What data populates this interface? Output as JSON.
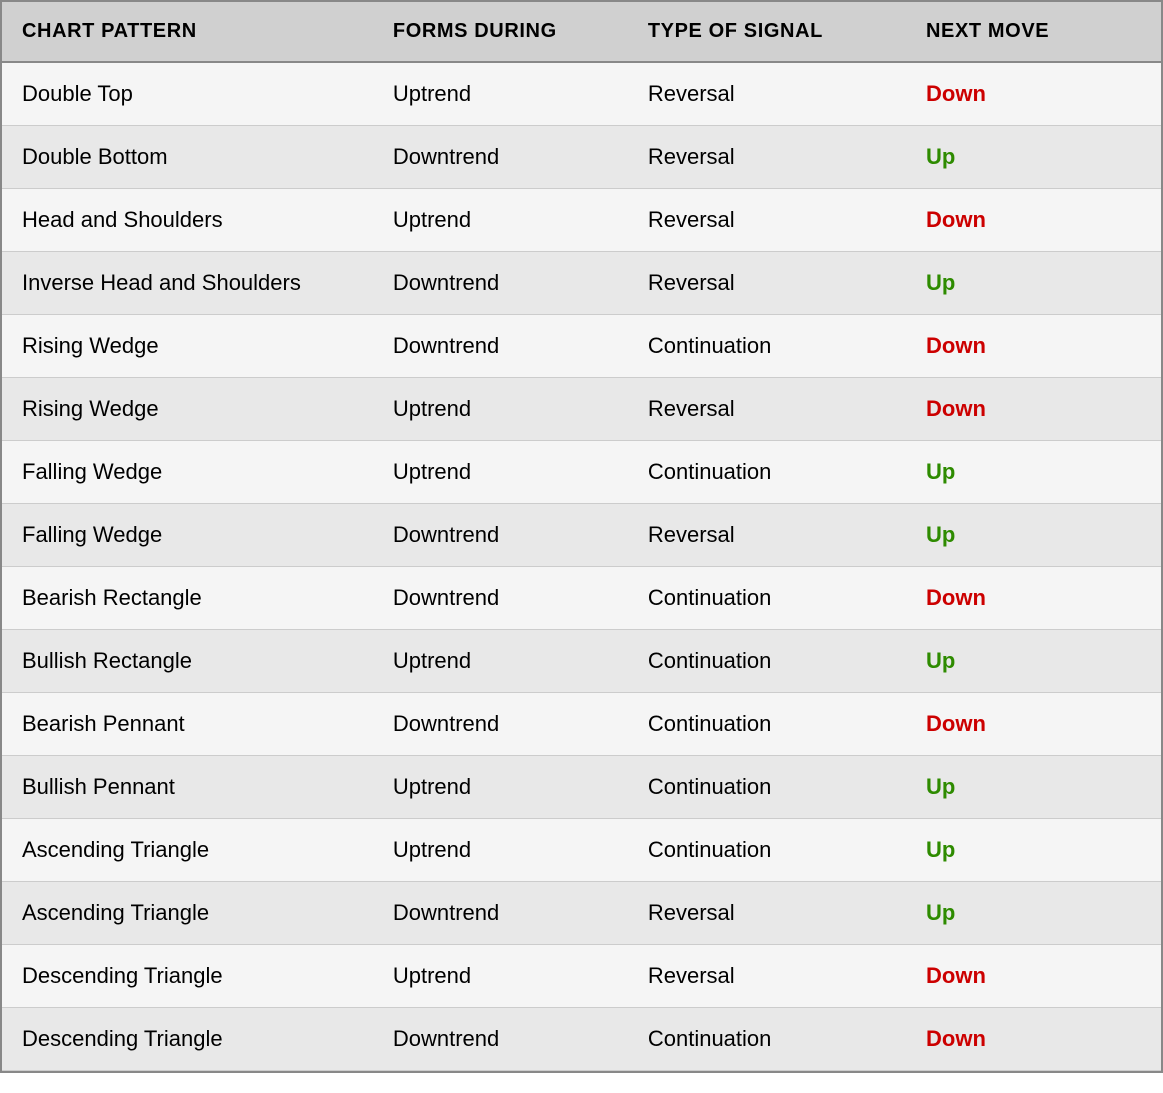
{
  "header": {
    "col1": "CHART PATTERN",
    "col2": "FORMS DURING",
    "col3": "TYPE OF SIGNAL",
    "col4": "NEXT MOVE"
  },
  "rows": [
    {
      "pattern": "Double Top",
      "forms": "Uptrend",
      "signal": "Reversal",
      "move": "Down",
      "moveClass": "down"
    },
    {
      "pattern": "Double Bottom",
      "forms": "Downtrend",
      "signal": "Reversal",
      "move": "Up",
      "moveClass": "up"
    },
    {
      "pattern": "Head and Shoulders",
      "forms": "Uptrend",
      "signal": "Reversal",
      "move": "Down",
      "moveClass": "down"
    },
    {
      "pattern": "Inverse Head and Shoulders",
      "forms": "Downtrend",
      "signal": "Reversal",
      "move": "Up",
      "moveClass": "up"
    },
    {
      "pattern": "Rising Wedge",
      "forms": "Downtrend",
      "signal": "Continuation",
      "move": "Down",
      "moveClass": "down"
    },
    {
      "pattern": "Rising Wedge",
      "forms": "Uptrend",
      "signal": "Reversal",
      "move": "Down",
      "moveClass": "down"
    },
    {
      "pattern": "Falling Wedge",
      "forms": "Uptrend",
      "signal": "Continuation",
      "move": "Up",
      "moveClass": "up"
    },
    {
      "pattern": "Falling Wedge",
      "forms": "Downtrend",
      "signal": "Reversal",
      "move": "Up",
      "moveClass": "up"
    },
    {
      "pattern": "Bearish Rectangle",
      "forms": "Downtrend",
      "signal": "Continuation",
      "move": "Down",
      "moveClass": "down"
    },
    {
      "pattern": "Bullish Rectangle",
      "forms": "Uptrend",
      "signal": "Continuation",
      "move": "Up",
      "moveClass": "up"
    },
    {
      "pattern": "Bearish Pennant",
      "forms": "Downtrend",
      "signal": "Continuation",
      "move": "Down",
      "moveClass": "down"
    },
    {
      "pattern": "Bullish Pennant",
      "forms": "Uptrend",
      "signal": "Continuation",
      "move": "Up",
      "moveClass": "up"
    },
    {
      "pattern": "Ascending Triangle",
      "forms": "Uptrend",
      "signal": "Continuation",
      "move": "Up",
      "moveClass": "up"
    },
    {
      "pattern": "Ascending Triangle",
      "forms": "Downtrend",
      "signal": "Reversal",
      "move": "Up",
      "moveClass": "up"
    },
    {
      "pattern": "Descending Triangle",
      "forms": "Uptrend",
      "signal": "Reversal",
      "move": "Down",
      "moveClass": "down"
    },
    {
      "pattern": "Descending Triangle",
      "forms": "Downtrend",
      "signal": "Continuation",
      "move": "Down",
      "moveClass": "down"
    }
  ]
}
